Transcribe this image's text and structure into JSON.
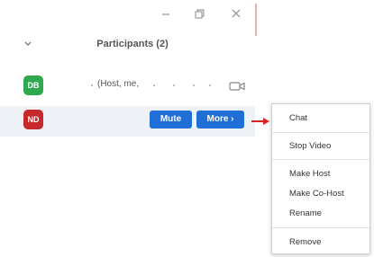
{
  "window": {
    "minimize_icon": "minimize-icon",
    "restore_icon": "restore-icon",
    "close_icon": "close-icon"
  },
  "header": {
    "collapse_icon": "chevron-down-icon",
    "title": "Participants (2)"
  },
  "participants": [
    {
      "initials": "DB",
      "avatar_color": "#2fa84f",
      "label": "(Host, me,",
      "camera_icon": "video-camera-icon"
    },
    {
      "initials": "ND",
      "avatar_color": "#c6282b",
      "mute_label": "Mute",
      "more_label": "More ›"
    }
  ],
  "context_menu": {
    "groups": [
      [
        "Chat"
      ],
      [
        "Stop Video"
      ],
      [
        "Make Host",
        "Make Co-Host",
        "Rename"
      ],
      [
        "Remove"
      ]
    ]
  },
  "colors": {
    "accent_blue": "#1f6fd6",
    "pointer_arrow": "#e02020"
  }
}
